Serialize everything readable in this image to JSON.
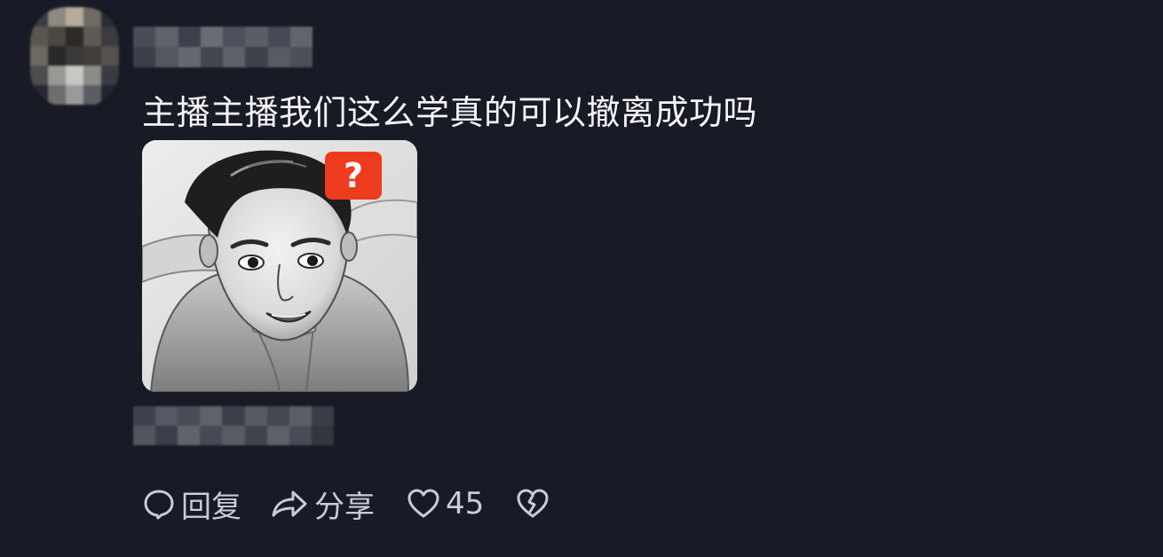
{
  "comment": {
    "text": "主播主播我们这么学真的可以撤离成功吗",
    "sticker": {
      "badge": "?",
      "description_icon": "sketch-face-sticker"
    }
  },
  "actions": {
    "reply_label": "回复",
    "share_label": "分享",
    "like_count": "45",
    "icons": [
      "comment-bubble-icon",
      "share-arrow-icon",
      "heart-icon",
      "broken-heart-icon"
    ]
  },
  "colors": {
    "background": "#181a25",
    "text": "#f4f5f8",
    "action_text": "#c9ccd6",
    "badge": "#ee3b1e"
  }
}
